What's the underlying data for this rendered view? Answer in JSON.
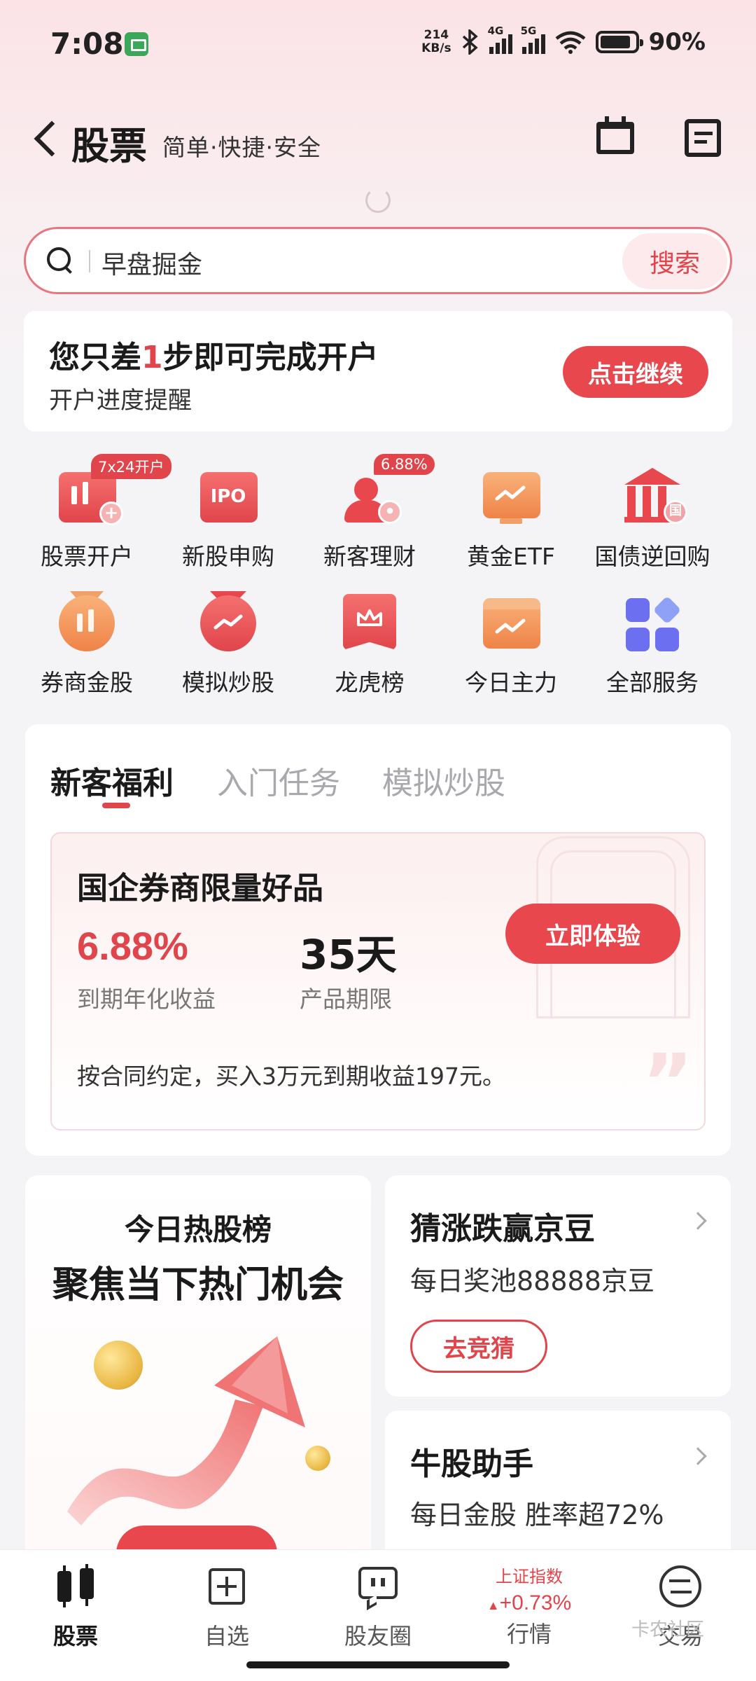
{
  "status": {
    "time": "7:08",
    "net_speed_top": "214",
    "net_speed_bottom": "KB/s",
    "sig1": "4G",
    "sig2": "5G",
    "battery": "90%"
  },
  "header": {
    "title": "股票",
    "subtitle": "简单·快捷·安全"
  },
  "search": {
    "placeholder": "早盘掘金",
    "button": "搜索"
  },
  "account": {
    "title_pre": "您只差",
    "title_hl": "1",
    "title_post": "步即可完成开户",
    "subtitle": "开户进度提醒",
    "button": "点击继续"
  },
  "grid": [
    {
      "label": "股票开户",
      "badge": "7x24开户",
      "icon": "stock-account-icon"
    },
    {
      "label": "新股申购",
      "icon_text": "IPO",
      "icon": "ipo-icon"
    },
    {
      "label": "新客理财",
      "badge": "6.88%",
      "icon": "wealth-icon"
    },
    {
      "label": "黄金ETF",
      "icon": "gold-etf-icon"
    },
    {
      "label": "国债逆回购",
      "icon_text": "国",
      "icon": "treasury-repo-icon"
    },
    {
      "label": "券商金股",
      "icon": "broker-stock-icon"
    },
    {
      "label": "模拟炒股",
      "icon": "simulated-trading-icon"
    },
    {
      "label": "龙虎榜",
      "icon": "dragon-tiger-icon"
    },
    {
      "label": "今日主力",
      "icon": "main-force-icon"
    },
    {
      "label": "全部服务",
      "icon": "all-services-icon"
    }
  ],
  "welfare": {
    "tabs": [
      "新客福利",
      "入门任务",
      "模拟炒股"
    ],
    "promo_title": "国企券商限量好品",
    "rate": "6.88%",
    "rate_label": "到期年化收益",
    "period": "35天",
    "period_label": "产品期限",
    "button": "立即体验",
    "note": "按合同约定，买入3万元到期收益197元。"
  },
  "hot": {
    "title": "今日热股榜",
    "subtitle": "聚焦当下热门机会"
  },
  "guess": {
    "title": "猜涨跌赢京豆",
    "subtitle": "每日奖池88888京豆",
    "button": "去竞猜"
  },
  "bull": {
    "title": "牛股助手",
    "subtitle": "每日金股 胜率超72%"
  },
  "nav": {
    "stock": "股票",
    "watchlist": "自选",
    "community": "股友圈",
    "market_index": "上证指数",
    "market_change": "+0.73%",
    "market": "行情",
    "trade": "交易"
  },
  "watermark": "卡农社区",
  "colors": {
    "accent": "#e0454b",
    "button": "#e8484d",
    "page_bg": "#f4f4f7"
  }
}
